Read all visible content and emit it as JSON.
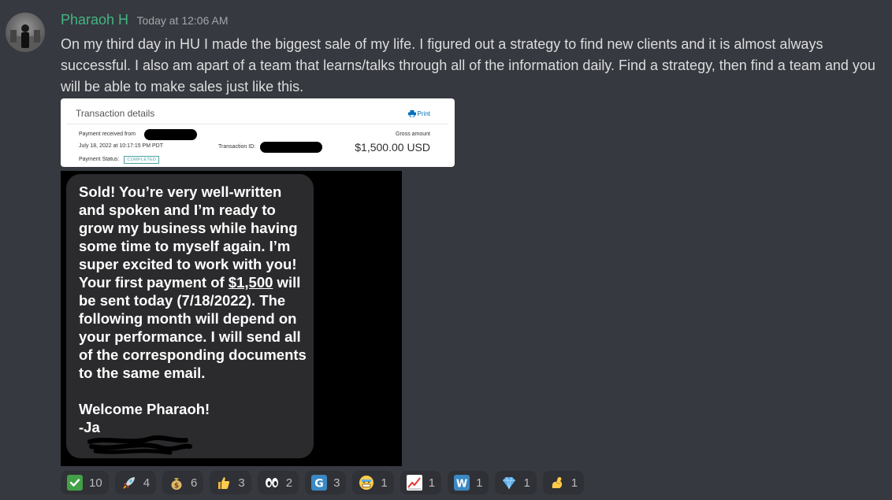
{
  "message": {
    "author": "Pharaoh H",
    "timestamp": "Today at 12:06 AM",
    "text": "On my third day in HU I made the biggest sale of my life. I figured out a strategy to find new clients and it is almost always successful. I also am apart of a team that learns/talks through all of the information daily. Find a strategy, then find a team and you will be able to make sales just like this."
  },
  "transaction": {
    "title": "Transaction details",
    "print_label": "Print",
    "payment_from_label": "Payment received from",
    "date": "July 18, 2022 at 10:17:15 PM PDT",
    "transaction_id_label": "Transaction ID:",
    "status_label": "Payment Status:",
    "status_value": "COMPLETED",
    "gross_label": "Gross amount",
    "gross_value": "$1,500.00 USD"
  },
  "sms": {
    "text_before_link": "Sold! You’re very well-written and spoken and I’m ready to grow my business while having some time to myself again. I’m super excited to work with you! Your first payment of ",
    "link_amount": "$1,500",
    "text_after_link": " will be sent today (7/18/2022). The following month will depend on your performance. I will send all of the corresponding documents to the same email.\n\nWelcome Pharaoh!\n-Ja"
  },
  "reactions": [
    {
      "icon": "check-mark-icon",
      "count": "10"
    },
    {
      "icon": "rocket-icon",
      "count": "4"
    },
    {
      "icon": "money-bag-icon",
      "count": "6"
    },
    {
      "icon": "thumbs-up-icon",
      "count": "3"
    },
    {
      "icon": "eyes-icon",
      "count": "2"
    },
    {
      "icon": "g-letter-icon",
      "count": "3"
    },
    {
      "icon": "face-icon",
      "count": "1"
    },
    {
      "icon": "chart-up-icon",
      "count": "1"
    },
    {
      "icon": "w-letter-icon",
      "count": "1"
    },
    {
      "icon": "gem-icon",
      "count": "1"
    },
    {
      "icon": "flexed-biceps-icon",
      "count": "1"
    }
  ],
  "colors": {
    "background": "#36393f",
    "username": "#43b581",
    "reaction_bg": "#2f3136"
  }
}
